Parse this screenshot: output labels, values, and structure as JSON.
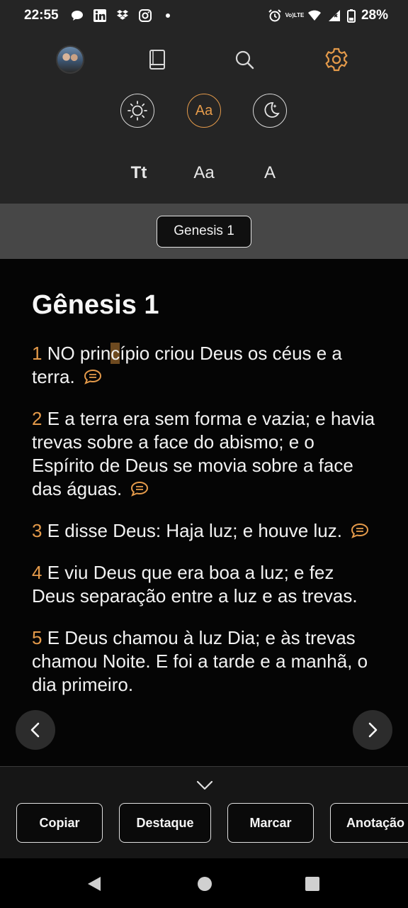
{
  "status_bar": {
    "time": "22:55",
    "battery": "28%",
    "network_label_top": "Vo)",
    "network_label_bottom": "LTE",
    "icons": [
      "chat-bubble-icon",
      "linkedin-icon",
      "dropbox-icon",
      "instagram-icon",
      "dot-icon",
      "alarm-icon",
      "wifi-icon",
      "signal-icon",
      "battery-icon"
    ]
  },
  "top_nav": {
    "icons": [
      "avatar",
      "book-icon",
      "search-icon",
      "gear-icon"
    ],
    "active_color": "#e49a4a"
  },
  "theme_options": {
    "items": [
      "sun-icon",
      "Aa",
      "moon-icon"
    ],
    "aa_label": "Aa"
  },
  "font_options": {
    "tt_label": "Tt",
    "aa_label": "Aa",
    "a_label": "A"
  },
  "chapter_selector": {
    "label": "Genesis 1"
  },
  "reader": {
    "title": "Gênesis 1",
    "verses": [
      {
        "num": "1",
        "text_before_cursor": "NO prin",
        "cursor_char": "c",
        "text_after_cursor": "ípio criou Deus os céus e a terra.",
        "has_note": true
      },
      {
        "num": "2",
        "text": "E a terra era sem forma e vazia; e havia trevas sobre a face do abismo; e o Espírito de Deus se movia sobre a face das águas.",
        "has_note": true
      },
      {
        "num": "3",
        "text": "E disse Deus: Haja luz; e houve luz.",
        "has_note": true
      },
      {
        "num": "4",
        "text": "E viu Deus que era boa a luz; e fez Deus separação entre a luz e as trevas.",
        "has_note": false
      },
      {
        "num": "5",
        "text": "E Deus chamou à luz Dia; e às trevas chamou Noite. E foi a tarde e a manhã, o dia primeiro.",
        "has_note": false
      }
    ],
    "accent": "#e49a4a"
  },
  "actions": {
    "copy": "Copiar",
    "highlight": "Destaque",
    "mark": "Marcar",
    "note": "Anotação"
  }
}
